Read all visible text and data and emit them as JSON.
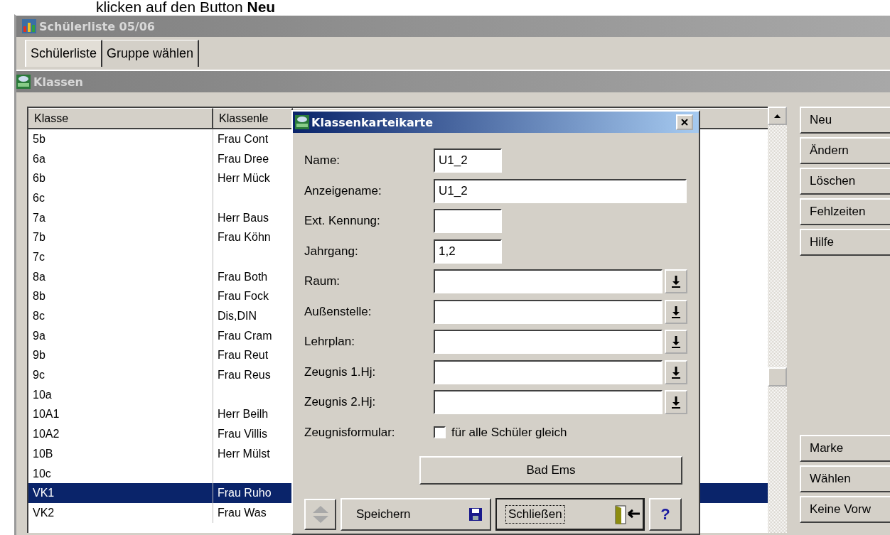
{
  "instruction": "klicken auf den Button **Neu**",
  "window": {
    "title": "Schülerliste 05/06"
  },
  "tabs": [
    {
      "label": "Schülerliste",
      "selected": true
    },
    {
      "label": "Gruppe wählen",
      "selected": false
    }
  ],
  "subwindow": {
    "title": "Klassen"
  },
  "table": {
    "columns": [
      "Klasse",
      "Klassenle"
    ],
    "rows": [
      {
        "class": "5b",
        "teacher": "Frau Cont",
        "selected": false
      },
      {
        "class": "6a",
        "teacher": "Frau Dree",
        "selected": false
      },
      {
        "class": "6b",
        "teacher": "Herr Mück",
        "selected": false
      },
      {
        "class": "6c",
        "selected": false
      },
      {
        "class": "7a",
        "teacher": "Herr Baus",
        "selected": false
      },
      {
        "class": "7b",
        "teacher": "Frau Köhn",
        "selected": false
      },
      {
        "class": "7c",
        "selected": false
      },
      {
        "class": "8a",
        "teacher": "Frau Both",
        "selected": false
      },
      {
        "class": "8b",
        "teacher": "Frau Fock",
        "selected": false
      },
      {
        "class": "8c",
        "teacher": "Dis,DIN",
        "selected": false
      },
      {
        "class": "9a",
        "teacher": "Frau Cram",
        "selected": false
      },
      {
        "class": "9b",
        "teacher": "Frau Reut",
        "selected": false
      },
      {
        "class": "9c",
        "teacher": "Frau Reus",
        "selected": false
      },
      {
        "class": "10a",
        "selected": false
      },
      {
        "class": "10A1",
        "teacher": "Herr Beilh",
        "selected": false
      },
      {
        "class": "10A2",
        "teacher": "Frau Villis",
        "selected": false
      },
      {
        "class": "10B",
        "teacher": "Herr Mülst",
        "selected": false
      },
      {
        "class": "10c",
        "selected": false
      },
      {
        "class": "VK1",
        "teacher": "Frau Ruho",
        "selected": true
      },
      {
        "class": "VK2",
        "teacher": "Frau Was",
        "selected": false
      }
    ]
  },
  "side_buttons": {
    "top": [
      "Neu",
      "Ändern",
      "Löschen",
      "Fehlzeiten",
      "Hilfe"
    ],
    "bottom": [
      "Marke",
      "Wählen",
      "Keine Vorw"
    ]
  },
  "dialog": {
    "title": "Klassenkarteikarte",
    "fields": [
      {
        "label": "Name:",
        "kind": "short",
        "value": "U1_2"
      },
      {
        "label": "Anzeigename:",
        "kind": "wide",
        "value": "U1_2"
      },
      {
        "label": "Ext. Kennung:",
        "kind": "short"
      },
      {
        "label": "Jahrgang:",
        "kind": "short",
        "value": "1,2"
      },
      {
        "label": "Raum:",
        "kind": "combo"
      },
      {
        "label": "Außenstelle:",
        "kind": "combo"
      },
      {
        "label": "Lehrplan:",
        "kind": "combo"
      },
      {
        "label": "Zeugnis 1.Hj:",
        "kind": "combo"
      },
      {
        "label": "Zeugnis 2.Hj:",
        "kind": "combo"
      }
    ],
    "checkbox": {
      "label": "Zeugnisformular:",
      "text": "für alle Schüler gleich",
      "checked": false
    },
    "location_button": "Bad Ems",
    "buttons": [
      {
        "kind": "save",
        "label": "Speichern",
        "focused": false
      },
      {
        "kind": "close",
        "label": "Schließen",
        "focused": true
      },
      {
        "kind": "help",
        "label": "?",
        "focused": false
      }
    ]
  }
}
